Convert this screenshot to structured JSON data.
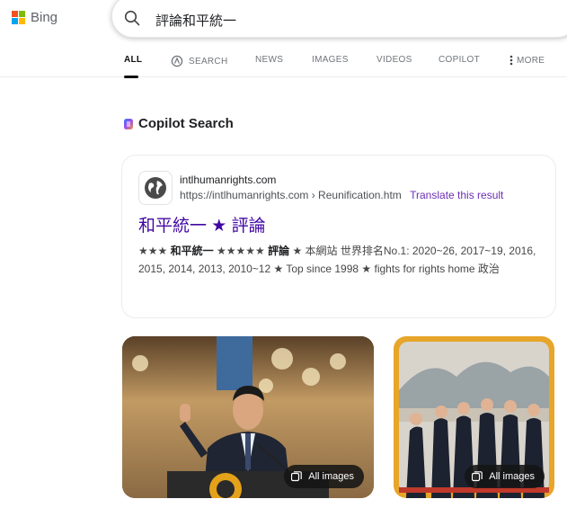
{
  "header": {
    "logo_text": "Bing",
    "search_query": "評論和平統一"
  },
  "tabs": [
    {
      "label": "ALL",
      "active": true
    },
    {
      "label": "SEARCH",
      "icon": "copilot-search-icon"
    },
    {
      "label": "NEWS"
    },
    {
      "label": "IMAGES"
    },
    {
      "label": "VIDEOS"
    },
    {
      "label": "COPILOT"
    },
    {
      "label": "MORE",
      "icon": "more-vertical-icon"
    }
  ],
  "copilot": {
    "title": "Copilot Search"
  },
  "result": {
    "site_name": "intlhumanrights.com",
    "url": "https://intlhumanrights.com › Reunification.htm",
    "translate_label": "Translate this result",
    "title": "和平統一 ★ 評論",
    "snippet_prefix": "★★★ ",
    "snippet_bold1": "和平統一",
    "snippet_mid": " ★★★★★ ",
    "snippet_bold2": "評論",
    "snippet_rest": " ★ 本網站 世界排名No.1: 2020~26, 2017~19, 2016, 2015, 2014, 2013, 2010~12 ★ Top since 1998 ★ fights for rights home 政治"
  },
  "images": [
    {
      "button_label": "All images"
    },
    {
      "button_label": "All images"
    }
  ],
  "colors": {
    "link_purple": "#4007a2",
    "translate_purple": "#6b2fb3",
    "image2_frame": "#e7a52a"
  }
}
